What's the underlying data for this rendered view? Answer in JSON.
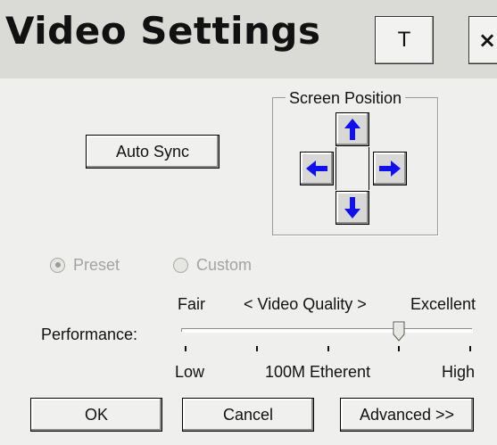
{
  "window": {
    "title": "Video Settings"
  },
  "titlebar": {
    "topmost_label": "T",
    "close_label": "×"
  },
  "auto_sync": {
    "label": "Auto Sync"
  },
  "screen_position": {
    "label": "Screen Position",
    "buttons": [
      "up-arrow-icon",
      "left-arrow-icon",
      "right-arrow-icon",
      "down-arrow-icon"
    ],
    "arrow_color": "#1010ee"
  },
  "mode": {
    "options": [
      {
        "label": "Preset",
        "selected": true,
        "enabled": false
      },
      {
        "label": "Custom",
        "selected": false,
        "enabled": false
      }
    ]
  },
  "quality": {
    "top_labels": {
      "left": "Fair",
      "center": "< Video Quality >",
      "right": "Excellent"
    },
    "performance_label": "Performance:",
    "bottom_labels": {
      "left": "Low",
      "center": "100M Etherent",
      "right": "High"
    },
    "slider_level": 0.75,
    "tick_count": 5
  },
  "footer": {
    "ok_label": "OK",
    "cancel_label": "Cancel",
    "advanced_label": "Advanced >>"
  }
}
